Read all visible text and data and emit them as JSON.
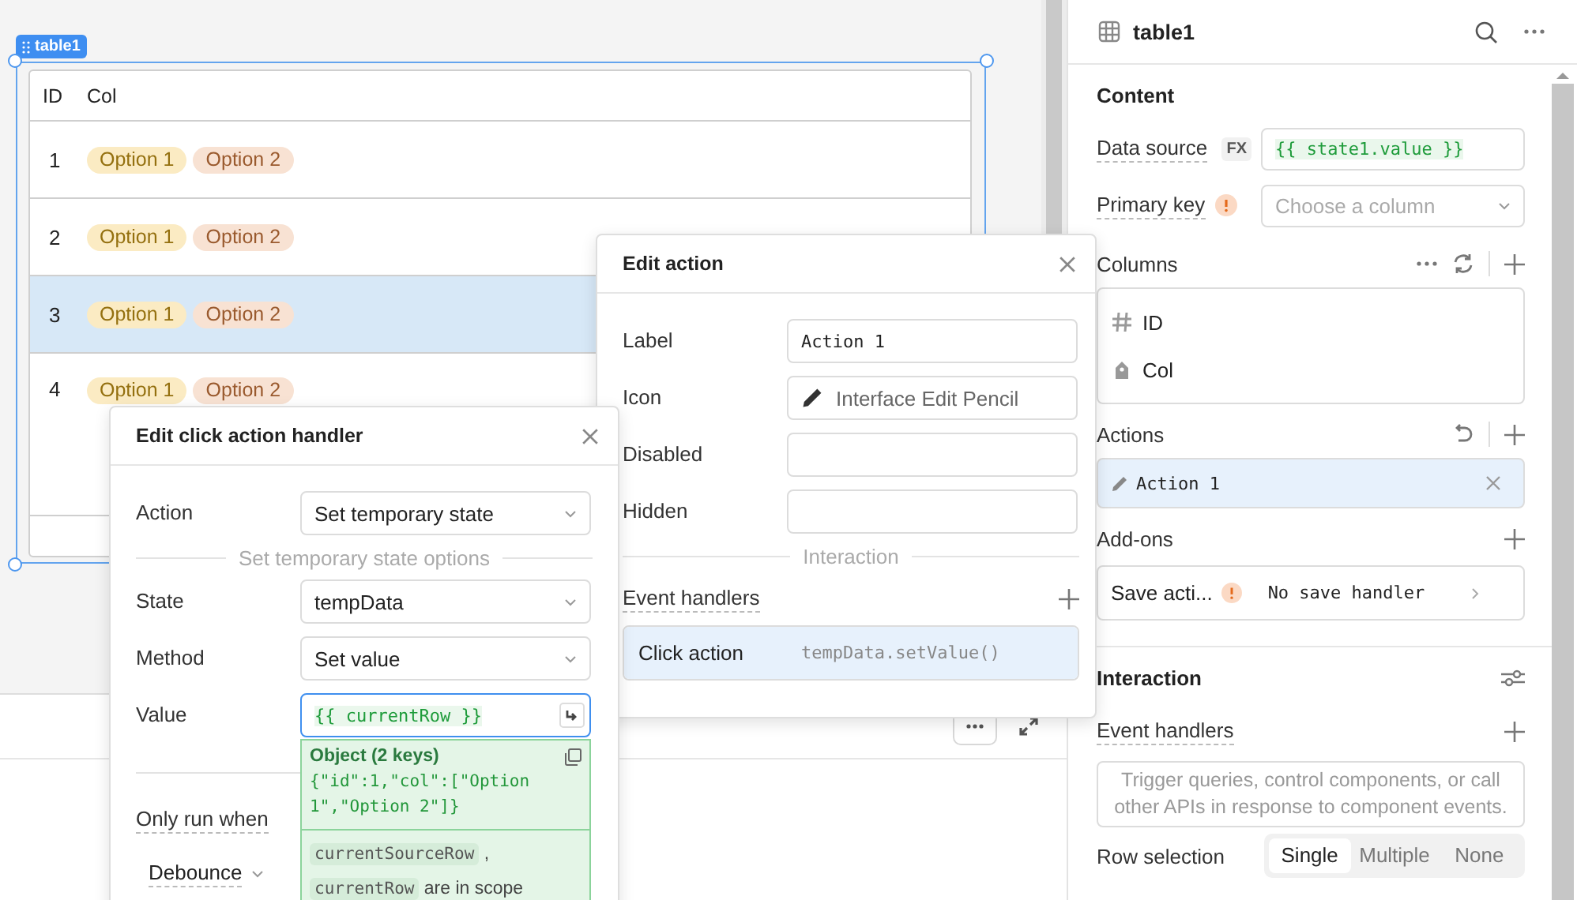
{
  "canvas": {
    "component_badge": "table1",
    "table": {
      "columns": [
        "ID",
        "Col"
      ],
      "rows": [
        {
          "id": "1",
          "selected": false,
          "tags": [
            {
              "text": "Option 1",
              "color": "#fbebc3"
            },
            {
              "text": "Option 2",
              "color": "#f8e2d3"
            }
          ]
        },
        {
          "id": "2",
          "selected": false,
          "tags": [
            {
              "text": "Option 1",
              "color": "#fbebc3"
            },
            {
              "text": "Option 2",
              "color": "#f8e2d3"
            }
          ]
        },
        {
          "id": "3",
          "selected": true,
          "tags": [
            {
              "text": "Option 1",
              "color": "#fbebc3"
            },
            {
              "text": "Option 2",
              "color": "#f8e2d3"
            }
          ]
        },
        {
          "id": "4",
          "selected": false,
          "tags": [
            {
              "text": "Option 1",
              "color": "#fbebc3"
            },
            {
              "text": "Option 2",
              "color": "#f8e2d3"
            }
          ]
        }
      ]
    }
  },
  "inspector": {
    "title": "table1",
    "content_heading": "Content",
    "data_source": {
      "label": "Data source",
      "badge": "FX",
      "value": "{{ state1.value }}"
    },
    "primary_key": {
      "label": "Primary key",
      "placeholder": "Choose a column"
    },
    "columns_heading": "Columns",
    "columns": [
      {
        "kind": "number",
        "name": "ID"
      },
      {
        "kind": "tag",
        "name": "Col"
      }
    ],
    "actions_heading": "Actions",
    "actions": [
      {
        "label": "Action 1",
        "selected": true
      }
    ],
    "addons_heading": "Add-ons",
    "addons": [
      {
        "name": "Save acti...",
        "value": "No save handler"
      }
    ],
    "interaction_heading": "Interaction",
    "event_handlers_label": "Event handlers",
    "event_handlers_placeholder": "Trigger queries, control components, or call other APIs in response to component events.",
    "row_selection": {
      "label": "Row selection",
      "options": [
        {
          "label": "Single",
          "selected": true
        },
        {
          "label": "Multiple",
          "selected": false
        },
        {
          "label": "None",
          "selected": false
        }
      ]
    }
  },
  "edit_action": {
    "title": "Edit action",
    "fields": [
      {
        "label": "Label",
        "kind": "text",
        "value": "Action 1"
      },
      {
        "label": "Icon",
        "kind": "icon",
        "value": "Interface Edit Pencil"
      },
      {
        "label": "Disabled",
        "kind": "text"
      },
      {
        "label": "Hidden",
        "kind": "text"
      }
    ],
    "section": "Interaction",
    "event_handlers_label": "Event handlers",
    "handlers": [
      {
        "event": "Click action",
        "method": "tempData.setValue()",
        "selected": true
      }
    ]
  },
  "click_handler": {
    "title": "Edit click action handler",
    "action": {
      "label": "Action",
      "value": "Set temporary state"
    },
    "section": "Set temporary state options",
    "selects": [
      {
        "label": "State",
        "value": "tempData"
      },
      {
        "label": "Method",
        "value": "Set value"
      }
    ],
    "value": {
      "label": "Value",
      "code": "{{ currentRow }}"
    },
    "preview": {
      "type": "Object (2 keys)",
      "json": "{\"id\":1,\"col\":[\"Option 1\",\"Option 2\"]}",
      "scope_vars": [
        "currentSourceRow",
        "currentRow"
      ],
      "scope_separator": ",",
      "scope_suffix": "are in scope"
    },
    "only_run_when": "Only run when",
    "debounce": "Debounce"
  }
}
